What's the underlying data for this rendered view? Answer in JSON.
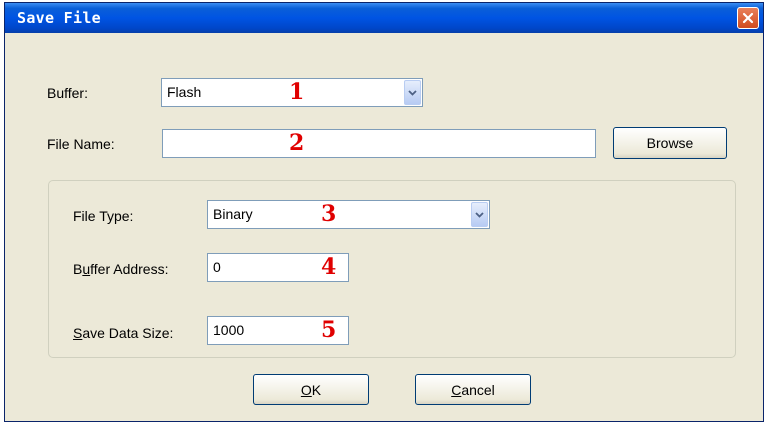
{
  "dialog": {
    "title": "Save File",
    "close_icon": "close-x-icon",
    "accent_color": "#0054e3",
    "close_color": "#d14a1f"
  },
  "buffer": {
    "label": "Buffer:",
    "value": "Flash",
    "marker": "1"
  },
  "file_name": {
    "label": "File Name:",
    "value": "",
    "marker": "2",
    "browse_label": "Browse"
  },
  "file_type": {
    "label": "File Type:",
    "value": "Binary",
    "marker": "3"
  },
  "buffer_address": {
    "label_pre": "B",
    "label_u": "u",
    "label_post": "ffer Address:",
    "value": "0",
    "marker": "4"
  },
  "save_data_size": {
    "label_u": "S",
    "label_post": "ave Data Size:",
    "value": "1000",
    "marker": "5"
  },
  "buttons": {
    "ok_u": "O",
    "ok_post": "K",
    "cancel_u": "C",
    "cancel_post": "ancel"
  }
}
